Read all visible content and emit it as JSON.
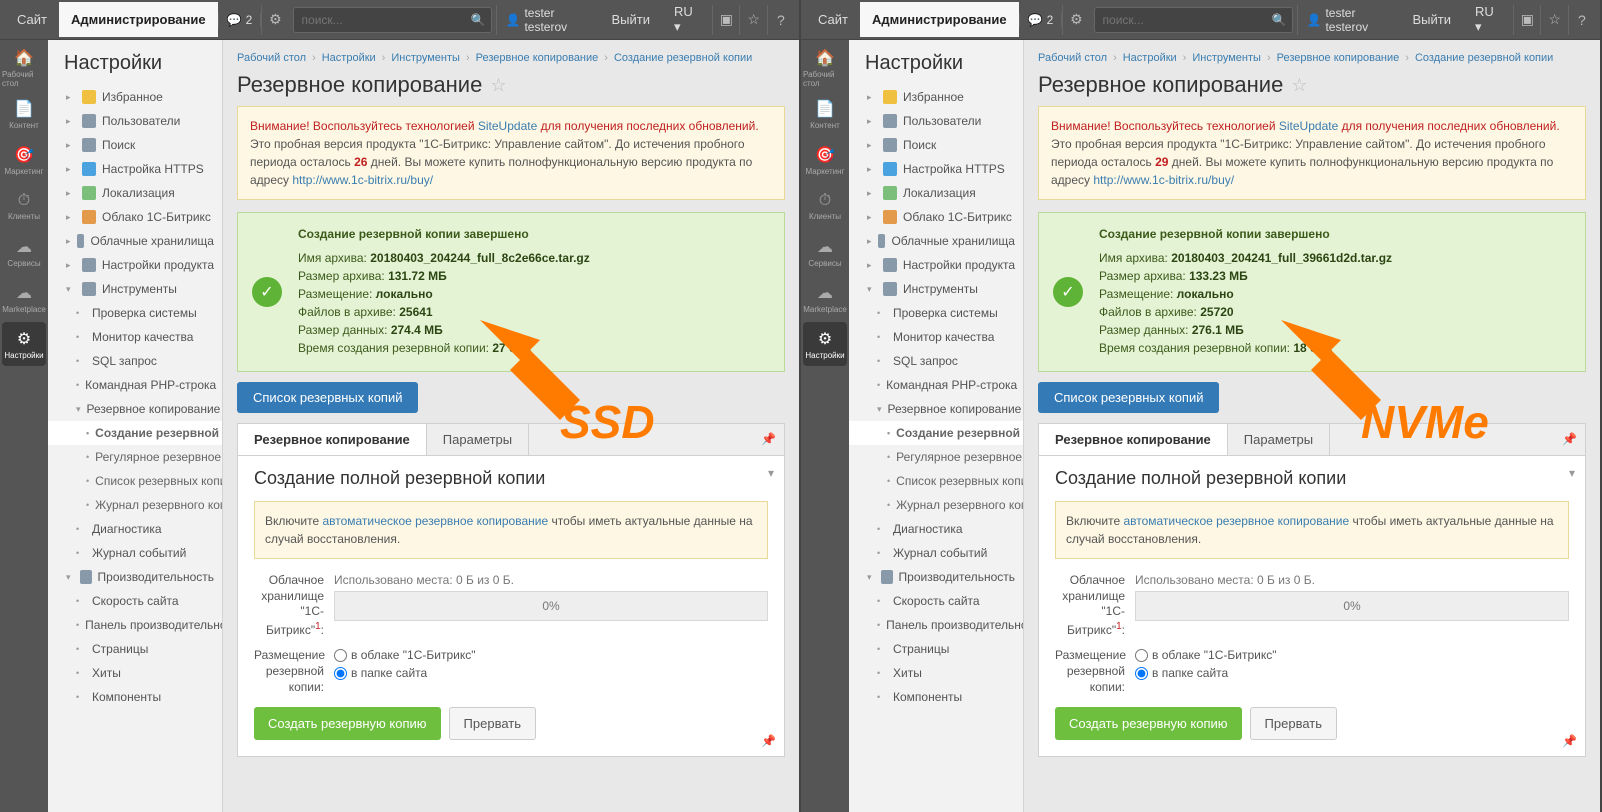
{
  "panels": [
    {
      "id": "ssd",
      "annot": "SSD",
      "warn_days": "26",
      "backup": {
        "file": "20180403_204244_full_8c2e66ce.tar.gz",
        "size": "131.72 МБ",
        "loc": "локально",
        "files": "25641",
        "data": "274.4 МБ",
        "time": "27 сек."
      }
    },
    {
      "id": "nvme",
      "annot": "NVMe",
      "warn_days": "29",
      "backup": {
        "file": "20180403_204241_full_39661d2d.tar.gz",
        "size": "133.23 МБ",
        "loc": "локально",
        "files": "25720",
        "data": "276.1 МБ",
        "time": "18 сек."
      }
    }
  ],
  "top": {
    "site": "Сайт",
    "admin": "Администрирование",
    "notif": "2",
    "search_ph": "поиск...",
    "user": "tester testerov",
    "logout": "Выйти",
    "lang": "RU"
  },
  "iconcol": [
    {
      "l": "Рабочий стол"
    },
    {
      "l": "Контент"
    },
    {
      "l": "Маркетинг"
    },
    {
      "l": "Клиенты"
    },
    {
      "l": "Сервисы"
    },
    {
      "l": "Marketplace"
    },
    {
      "l": "Настройки"
    }
  ],
  "nav": {
    "title": "Настройки",
    "items": [
      {
        "t": "Избранное",
        "ic": "#f0c040"
      },
      {
        "t": "Пользователи",
        "ic": "#89a"
      },
      {
        "t": "Поиск",
        "ic": "#89a"
      },
      {
        "t": "Настройка HTTPS",
        "ic": "#4aa3df"
      },
      {
        "t": "Локализация",
        "ic": "#7bbf7b"
      },
      {
        "t": "Облако 1С-Битрикс",
        "ic": "#e39b4b"
      },
      {
        "t": "Облачные хранилища",
        "ic": "#89a"
      },
      {
        "t": "Настройки продукта",
        "ic": "#89a"
      },
      {
        "t": "Инструменты",
        "ic": "#89a",
        "open": true,
        "children": [
          {
            "t": "Проверка системы"
          },
          {
            "t": "Монитор качества"
          },
          {
            "t": "SQL запрос"
          },
          {
            "t": "Командная PHP-строка"
          },
          {
            "t": "Резервное копирование",
            "open": true,
            "children": [
              {
                "t": "Создание резервной коп",
                "active": true
              },
              {
                "t": "Регулярное резервное к"
              },
              {
                "t": "Список резервных копий"
              },
              {
                "t": "Журнал резервного копи"
              }
            ]
          },
          {
            "t": "Диагностика"
          },
          {
            "t": "Журнал событий"
          }
        ]
      },
      {
        "t": "Производительность",
        "ic": "#89a",
        "open": true,
        "children": [
          {
            "t": "Скорость сайта"
          },
          {
            "t": "Панель производительнос"
          },
          {
            "t": "Страницы"
          },
          {
            "t": "Хиты"
          },
          {
            "t": "Компоненты"
          }
        ]
      }
    ]
  },
  "crumbs": [
    "Рабочий стол",
    "Настройки",
    "Инструменты",
    "Резервное копирование",
    "Создание резервной копии"
  ],
  "page": {
    "h1": "Резервное копирование",
    "warn": {
      "p1a": "Внимание! Воспользуйтесь технологией ",
      "link1": "SiteUpdate",
      "p1b": " для получения последних обновлений.",
      "p2a": "Это пробная версия продукта \"1С-Битрикс: Управление сайтом\". До истечения пробного периода осталось ",
      "p2b": " дней. Вы можете купить полнофункциональную версию продукта по адресу ",
      "link2": "http://www.1c-bitrix.ru/buy/"
    },
    "ok": {
      "title": "Создание резервной копии завершено",
      "l1": "Имя архива: ",
      "l2": "Размер архива: ",
      "l3": "Размещение: ",
      "l4": "Файлов в архиве: ",
      "l5": "Размер данных: ",
      "l6": "Время создания резервной копии: "
    },
    "listbtn": "Список резервных копий",
    "tabs": [
      "Резервное копирование",
      "Параметры"
    ],
    "card": {
      "h3": "Создание полной резервной копии",
      "info_a": "Включите ",
      "info_link": "автоматическое резервное копирование",
      "info_b": " чтобы иметь актуальные данные на случай восстановления.",
      "cloudlab": "Облачное хранилище \"1С-Битрикс\"",
      "cloudsup": "1",
      "usage": "Использовано места: 0 Б из 0 Б.",
      "progress": "0%",
      "placelab": "Размещение резервной копии:",
      "r1": "в облаке \"1С-Битрикс\"",
      "r2": "в папке сайта",
      "go": "Создать резервную копию",
      "cancel": "Прервать"
    }
  }
}
